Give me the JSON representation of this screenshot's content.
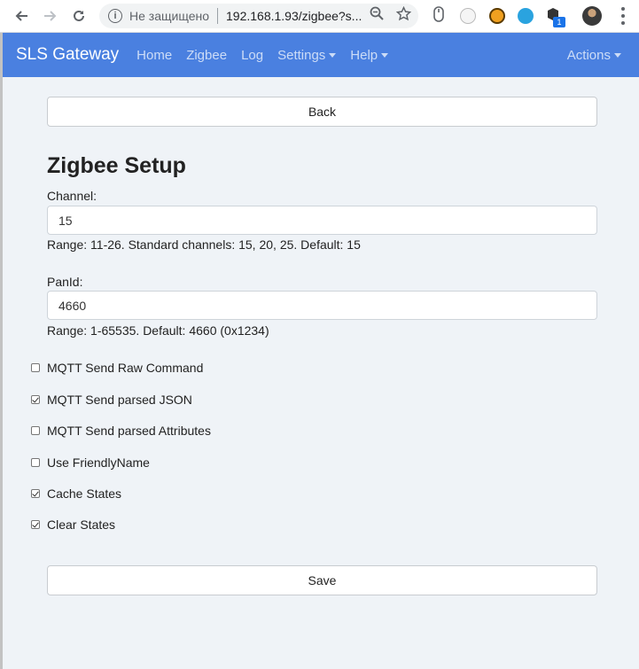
{
  "browser": {
    "security_label": "Не защищено",
    "url": "192.168.1.93/zigbee?s...",
    "extension_badge": "1"
  },
  "navbar": {
    "brand": "SLS Gateway",
    "links": [
      "Home",
      "Zigbee",
      "Log",
      "Settings",
      "Help"
    ],
    "actions": "Actions"
  },
  "page": {
    "back_button": "Back",
    "title": "Zigbee Setup",
    "channel": {
      "label": "Channel:",
      "value": "15",
      "help": "Range: 11-26. Standard channels: 15, 20, 25. Default: 15"
    },
    "panid": {
      "label": "PanId:",
      "value": "4660",
      "help": "Range: 1-65535. Default: 4660 (0x1234)"
    },
    "checkboxes": [
      {
        "label": "MQTT Send Raw Command",
        "checked": false
      },
      {
        "label": "MQTT Send parsed JSON",
        "checked": true
      },
      {
        "label": "MQTT Send parsed Attributes",
        "checked": false
      },
      {
        "label": "Use FriendlyName",
        "checked": false
      },
      {
        "label": "Cache States",
        "checked": true
      },
      {
        "label": "Clear States",
        "checked": true
      }
    ],
    "save_button": "Save"
  },
  "colors": {
    "navbar": "#4a80e0",
    "background": "#eff3f7"
  }
}
